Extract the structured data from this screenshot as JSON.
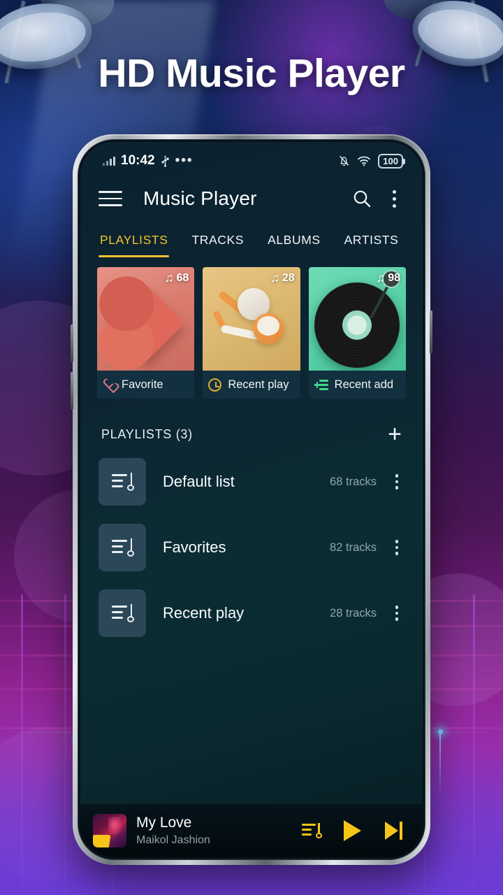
{
  "promo": {
    "headline": "HD Music Player"
  },
  "statusbar": {
    "time": "10:42",
    "signal_icon": "signal-bars-icon",
    "usb_icon": "usb-icon",
    "more_icon": "more-dots-icon",
    "notifications_off_icon": "bell-off-icon",
    "wifi_icon": "wifi-icon",
    "battery_level": "100"
  },
  "toolbar": {
    "menu_icon": "hamburger-menu-icon",
    "title": "Music Player",
    "search_icon": "search-icon",
    "overflow_icon": "kebab-menu-icon"
  },
  "tabs": [
    {
      "label": "PLAYLISTS",
      "active": true
    },
    {
      "label": "TRACKS",
      "active": false
    },
    {
      "label": "ALBUMS",
      "active": false
    },
    {
      "label": "ARTISTS",
      "active": false
    }
  ],
  "quick_cards": [
    {
      "label": "Favorite",
      "count": "68",
      "note_icon": "music-note-icon",
      "icon": "heart-outline-icon",
      "art": "paper-heart"
    },
    {
      "label": "Recent play",
      "count": "28",
      "note_icon": "music-note-icon",
      "icon": "clock-icon",
      "art": "earbuds"
    },
    {
      "label": "Recent add",
      "count": "98",
      "note_icon": "music-note-icon",
      "icon": "add-to-playlist-icon",
      "art": "vinyl-record"
    }
  ],
  "section": {
    "title": "PLAYLISTS  (3)",
    "add_label": "+"
  },
  "playlists": [
    {
      "name": "Default list",
      "tracks": "68 tracks",
      "icon": "playlist-icon",
      "menu_icon": "kebab-menu-icon"
    },
    {
      "name": "Favorites",
      "tracks": "82 tracks",
      "icon": "playlist-icon",
      "menu_icon": "kebab-menu-icon"
    },
    {
      "name": "Recent play",
      "tracks": "28 tracks",
      "icon": "playlist-icon",
      "menu_icon": "kebab-menu-icon"
    }
  ],
  "mini_player": {
    "title": "My Love",
    "artist": "Maikol Jashion",
    "album_art": "album-art-thumbnail",
    "queue_icon": "playlist-queue-icon",
    "play_icon": "play-icon",
    "next_icon": "skip-next-icon"
  },
  "colors": {
    "accent": "#f2c230",
    "player_accent": "#f5c518",
    "screen_bg": "#0b2430",
    "row_icon_bg": "#2b4758",
    "muted_text": "#8fa7b3"
  },
  "note_glyph": "♫"
}
